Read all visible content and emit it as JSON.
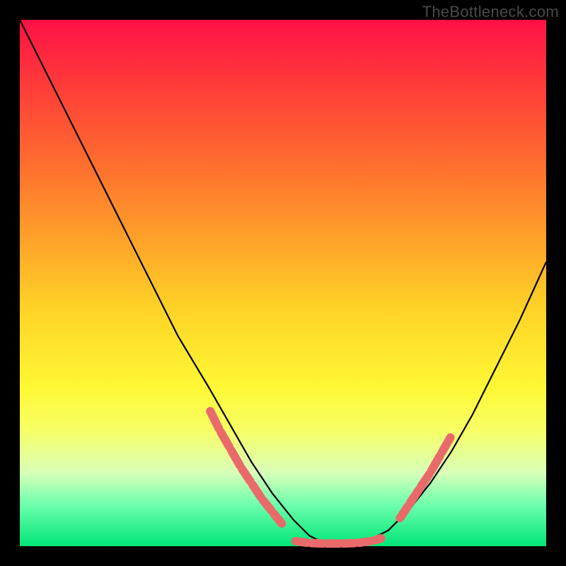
{
  "watermark": "TheBottleneck.com",
  "chart_data": {
    "type": "line",
    "title": "",
    "xlabel": "",
    "ylabel": "",
    "xlim": [
      0,
      100
    ],
    "ylim": [
      0,
      100
    ],
    "series": [
      {
        "name": "left-curve",
        "x": [
          0,
          6,
          12,
          18,
          24,
          30,
          36,
          40,
          44,
          48,
          52,
          55,
          58,
          60
        ],
        "y": [
          100,
          88,
          76,
          64,
          52,
          40,
          30,
          23,
          16,
          10,
          5,
          2,
          0.5,
          0
        ]
      },
      {
        "name": "right-curve",
        "x": [
          60,
          63,
          66,
          70,
          74,
          78,
          82,
          86,
          90,
          95,
          100
        ],
        "y": [
          0,
          0.3,
          1,
          3,
          7,
          12,
          18,
          25,
          33,
          43,
          54
        ]
      },
      {
        "name": "marker-band-left",
        "x": [
          36,
          38,
          40,
          42,
          44,
          46,
          48,
          50
        ],
        "y": [
          26,
          22,
          18.5,
          15,
          12,
          9,
          6.5,
          4
        ]
      },
      {
        "name": "marker-band-bottom",
        "x": [
          52,
          55,
          58,
          61,
          64,
          67,
          69
        ],
        "y": [
          1.0,
          0.6,
          0.5,
          0.5,
          0.6,
          1.0,
          1.6
        ]
      },
      {
        "name": "marker-band-right",
        "x": [
          72,
          74,
          76,
          78,
          80,
          82
        ],
        "y": [
          5,
          8,
          11,
          14,
          17.5,
          21
        ]
      }
    ],
    "colors": {
      "curve": "#000000",
      "markers": "#e96a6a"
    }
  }
}
